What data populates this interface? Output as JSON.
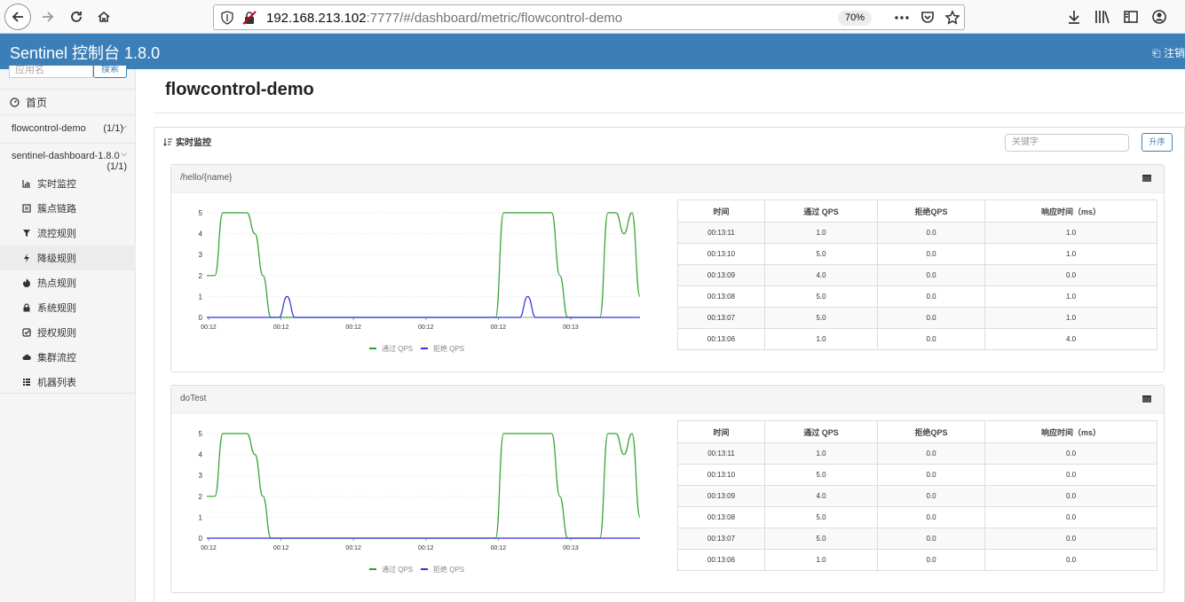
{
  "browser": {
    "url_host": "192.168.213.102",
    "url_rest": ":7777/#/dashboard/metric/flowcontrol-demo",
    "zoom": "70%"
  },
  "header": {
    "brand": "Sentinel 控制台 1.8.0",
    "logout": "注销"
  },
  "sidebar": {
    "search_placeholder": "应用名",
    "search_button": "搜索",
    "home": "首页",
    "apps": [
      {
        "name": "flowcontrol-demo",
        "count": "(1/1)"
      },
      {
        "name": "sentinel-dashboard-1.8.0",
        "count": "(1/1)"
      }
    ],
    "menu": [
      {
        "label": "实时监控",
        "icon": "bar-chart-icon"
      },
      {
        "label": "簇点链路",
        "icon": "list-icon"
      },
      {
        "label": "流控规则",
        "icon": "filter-icon"
      },
      {
        "label": "降级规则",
        "icon": "flash-icon"
      },
      {
        "label": "热点规则",
        "icon": "fire-icon"
      },
      {
        "label": "系统规则",
        "icon": "lock-icon"
      },
      {
        "label": "授权规则",
        "icon": "check-icon"
      },
      {
        "label": "集群流控",
        "icon": "cloud-icon"
      },
      {
        "label": "机器列表",
        "icon": "th-list-icon"
      }
    ]
  },
  "main": {
    "title": "flowcontrol-demo",
    "panel_title": "实时监控",
    "keyword_placeholder": "关键字",
    "sort_button": "升序",
    "table_headers": [
      "时间",
      "通过 QPS",
      "拒绝QPS",
      "响应时间（ms）"
    ],
    "legend": {
      "pass": "通过 QPS",
      "block": "拒绝 QPS"
    },
    "colors": {
      "pass": "#2ca02c",
      "block": "#3333dd",
      "brand": "#3c7fb8"
    },
    "resources": [
      {
        "name": "/hello/{name}",
        "rows": [
          [
            "00:13:11",
            "1.0",
            "0.0",
            "1.0"
          ],
          [
            "00:13:10",
            "5.0",
            "0.0",
            "1.0"
          ],
          [
            "00:13:09",
            "4.0",
            "0.0",
            "0.0"
          ],
          [
            "00:13:08",
            "5.0",
            "0.0",
            "1.0"
          ],
          [
            "00:13:07",
            "5.0",
            "0.0",
            "1.0"
          ],
          [
            "00:13:06",
            "1.0",
            "0.0",
            "4.0"
          ]
        ]
      },
      {
        "name": "doTest",
        "rows": [
          [
            "00:13:11",
            "1.0",
            "0.0",
            "0.0"
          ],
          [
            "00:13:10",
            "5.0",
            "0.0",
            "0.0"
          ],
          [
            "00:13:09",
            "4.0",
            "0.0",
            "0.0"
          ],
          [
            "00:13:08",
            "5.0",
            "0.0",
            "0.0"
          ],
          [
            "00:13:07",
            "5.0",
            "0.0",
            "0.0"
          ],
          [
            "00:13:06",
            "1.0",
            "0.0",
            "0.0"
          ]
        ]
      }
    ]
  },
  "chart_data": [
    {
      "type": "line",
      "yticks": [
        0,
        1,
        2,
        3,
        4,
        5
      ],
      "xticks": [
        "00:12",
        "00:12",
        "00:12",
        "00:12",
        "00:12",
        "00:13"
      ],
      "ylim": [
        0,
        5
      ],
      "series": [
        {
          "name": "通过 QPS",
          "color": "#2ca02c",
          "values": [
            2,
            2,
            5,
            5,
            5,
            5,
            4,
            2,
            0,
            0,
            0,
            0,
            0,
            0,
            0,
            0,
            0,
            0,
            0,
            0,
            0,
            0,
            0,
            0,
            0,
            0,
            0,
            0,
            0,
            0,
            0,
            0,
            0,
            0,
            0,
            0,
            0,
            5,
            5,
            5,
            5,
            5,
            5,
            5,
            2,
            0,
            0,
            0,
            0,
            0,
            5,
            5,
            4,
            5,
            1
          ]
        },
        {
          "name": "拒绝 QPS",
          "color": "#3333dd",
          "values": [
            0,
            0,
            0,
            0,
            0,
            0,
            0,
            0,
            0,
            0,
            1,
            0,
            0,
            0,
            0,
            0,
            0,
            0,
            0,
            0,
            0,
            0,
            0,
            0,
            0,
            0,
            0,
            0,
            0,
            0,
            0,
            0,
            0,
            0,
            0,
            0,
            0,
            0,
            0,
            0,
            1,
            0,
            0,
            0,
            0,
            0,
            0,
            0,
            0,
            0,
            0,
            0,
            0,
            0,
            0
          ]
        }
      ]
    },
    {
      "type": "line",
      "yticks": [
        0,
        1,
        2,
        3,
        4,
        5
      ],
      "xticks": [
        "00:12",
        "00:12",
        "00:12",
        "00:12",
        "00:12",
        "00:13"
      ],
      "ylim": [
        0,
        5
      ],
      "series": [
        {
          "name": "通过 QPS",
          "color": "#2ca02c",
          "values": [
            2,
            2,
            5,
            5,
            5,
            5,
            4,
            2,
            0,
            0,
            0,
            0,
            0,
            0,
            0,
            0,
            0,
            0,
            0,
            0,
            0,
            0,
            0,
            0,
            0,
            0,
            0,
            0,
            0,
            0,
            0,
            0,
            0,
            0,
            0,
            0,
            0,
            5,
            5,
            5,
            5,
            5,
            5,
            5,
            2,
            0,
            0,
            0,
            0,
            0,
            5,
            5,
            4,
            5,
            1
          ]
        },
        {
          "name": "拒绝 QPS",
          "color": "#3333dd",
          "values": [
            0,
            0,
            0,
            0,
            0,
            0,
            0,
            0,
            0,
            0,
            0,
            0,
            0,
            0,
            0,
            0,
            0,
            0,
            0,
            0,
            0,
            0,
            0,
            0,
            0,
            0,
            0,
            0,
            0,
            0,
            0,
            0,
            0,
            0,
            0,
            0,
            0,
            0,
            0,
            0,
            0,
            0,
            0,
            0,
            0,
            0,
            0,
            0,
            0,
            0,
            0,
            0,
            0,
            0,
            0
          ]
        }
      ]
    }
  ]
}
